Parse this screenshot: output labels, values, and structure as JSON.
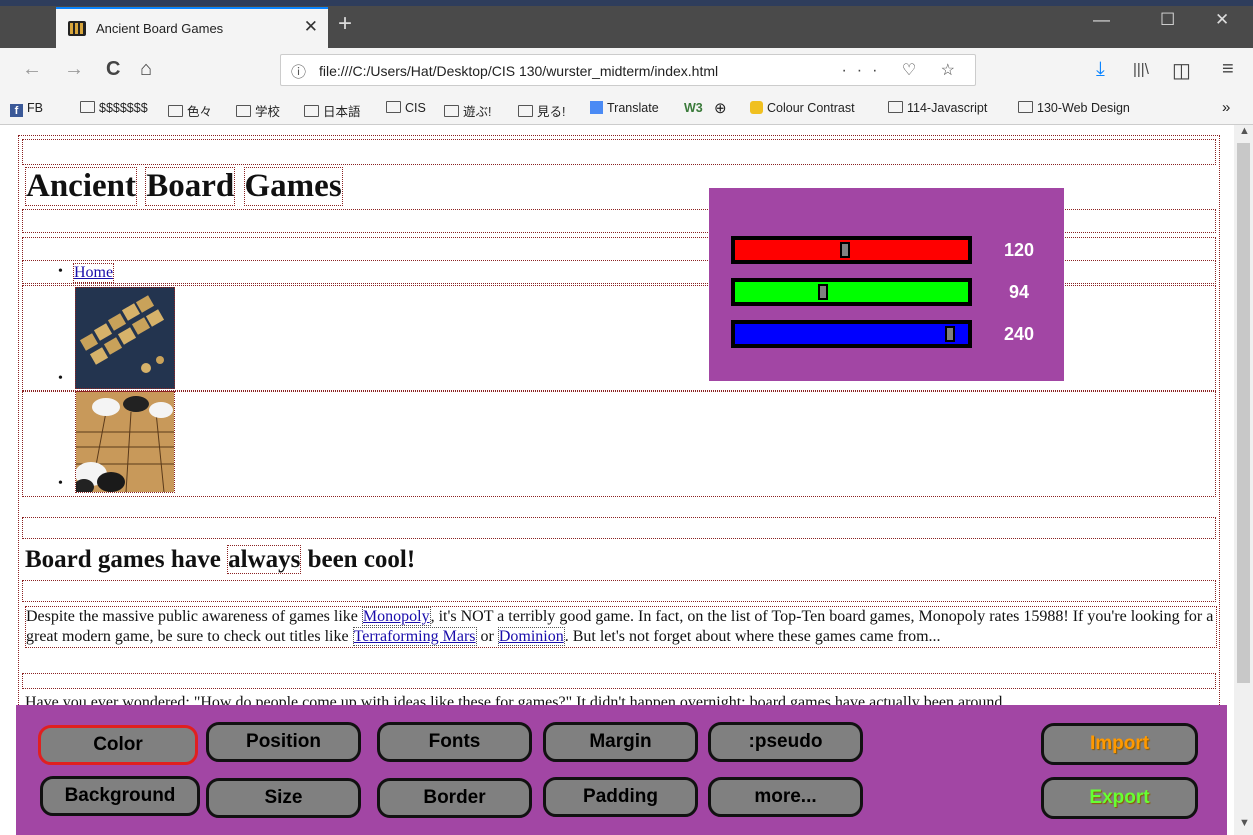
{
  "browser": {
    "tab_title": "Ancient Board Games",
    "tab_close": "✕",
    "new_tab": "+",
    "url_info": "ⓘ",
    "url": "file:///C:/Users/Hat/Desktop/CIS 130/wurster_midterm/index.html",
    "url_icons": "··· ♡ ☆",
    "window_controls": [
      "—",
      "☐",
      "✕"
    ],
    "nav": {
      "back": "←",
      "forward": "→",
      "reload": "C",
      "home": "⌂",
      "download": "⤓",
      "library": "|||\\",
      "sidebar": "◫",
      "menu": "≡"
    },
    "bookmarks": [
      "FB",
      "$$$$$$$",
      "色々",
      "学校",
      "日本語",
      "CIS",
      "遊ぶ!",
      "見る!",
      "Translate",
      "W3",
      "⊕",
      "Colour Contrast",
      "114-Javascript",
      "130-Web Design"
    ],
    "bookmarks_overflow": "»"
  },
  "page": {
    "title_words": [
      "Ancient",
      "Board",
      "Games"
    ],
    "nav_link": "Home",
    "heading": {
      "before": "Board games have ",
      "emph": "always",
      "after": " been cool!"
    },
    "p1": {
      "t1": "Despite the massive public awareness of games like ",
      "l1": "Monopoly",
      "t2": ", it's NOT a terribly good game. In fact, on the list of Top-Ten board games, Monopoly rates 15988! If you're looking for a great modern game, be sure to check out titles like ",
      "l2": "Terraforming Mars",
      "t3": " or ",
      "l3": "Dominion",
      "t4": ". But let's not forget about where these games came from..."
    },
    "p2": "Have you ever wondered: \"How do people come up with ideas like these for games?\" It didn't happen overnight; board games have actually been around"
  },
  "picker": {
    "red": {
      "value": "120",
      "level": 0.47,
      "color": "#ff0000"
    },
    "green": {
      "value": "94",
      "level": 0.37,
      "color": "#00ff00"
    },
    "blue": {
      "value": "240",
      "level": 0.94,
      "color": "#0000ff"
    },
    "background": "#a246a4"
  },
  "toolbar": {
    "row1": [
      "Color",
      "Position",
      "Fonts",
      "Margin",
      ":pseudo"
    ],
    "row2": [
      "Background",
      "Size",
      "Border",
      "Padding",
      "more..."
    ],
    "import": "Import",
    "export": "Export",
    "import_color": "#ff9900",
    "export_color": "#66ff33",
    "active": "Color"
  }
}
